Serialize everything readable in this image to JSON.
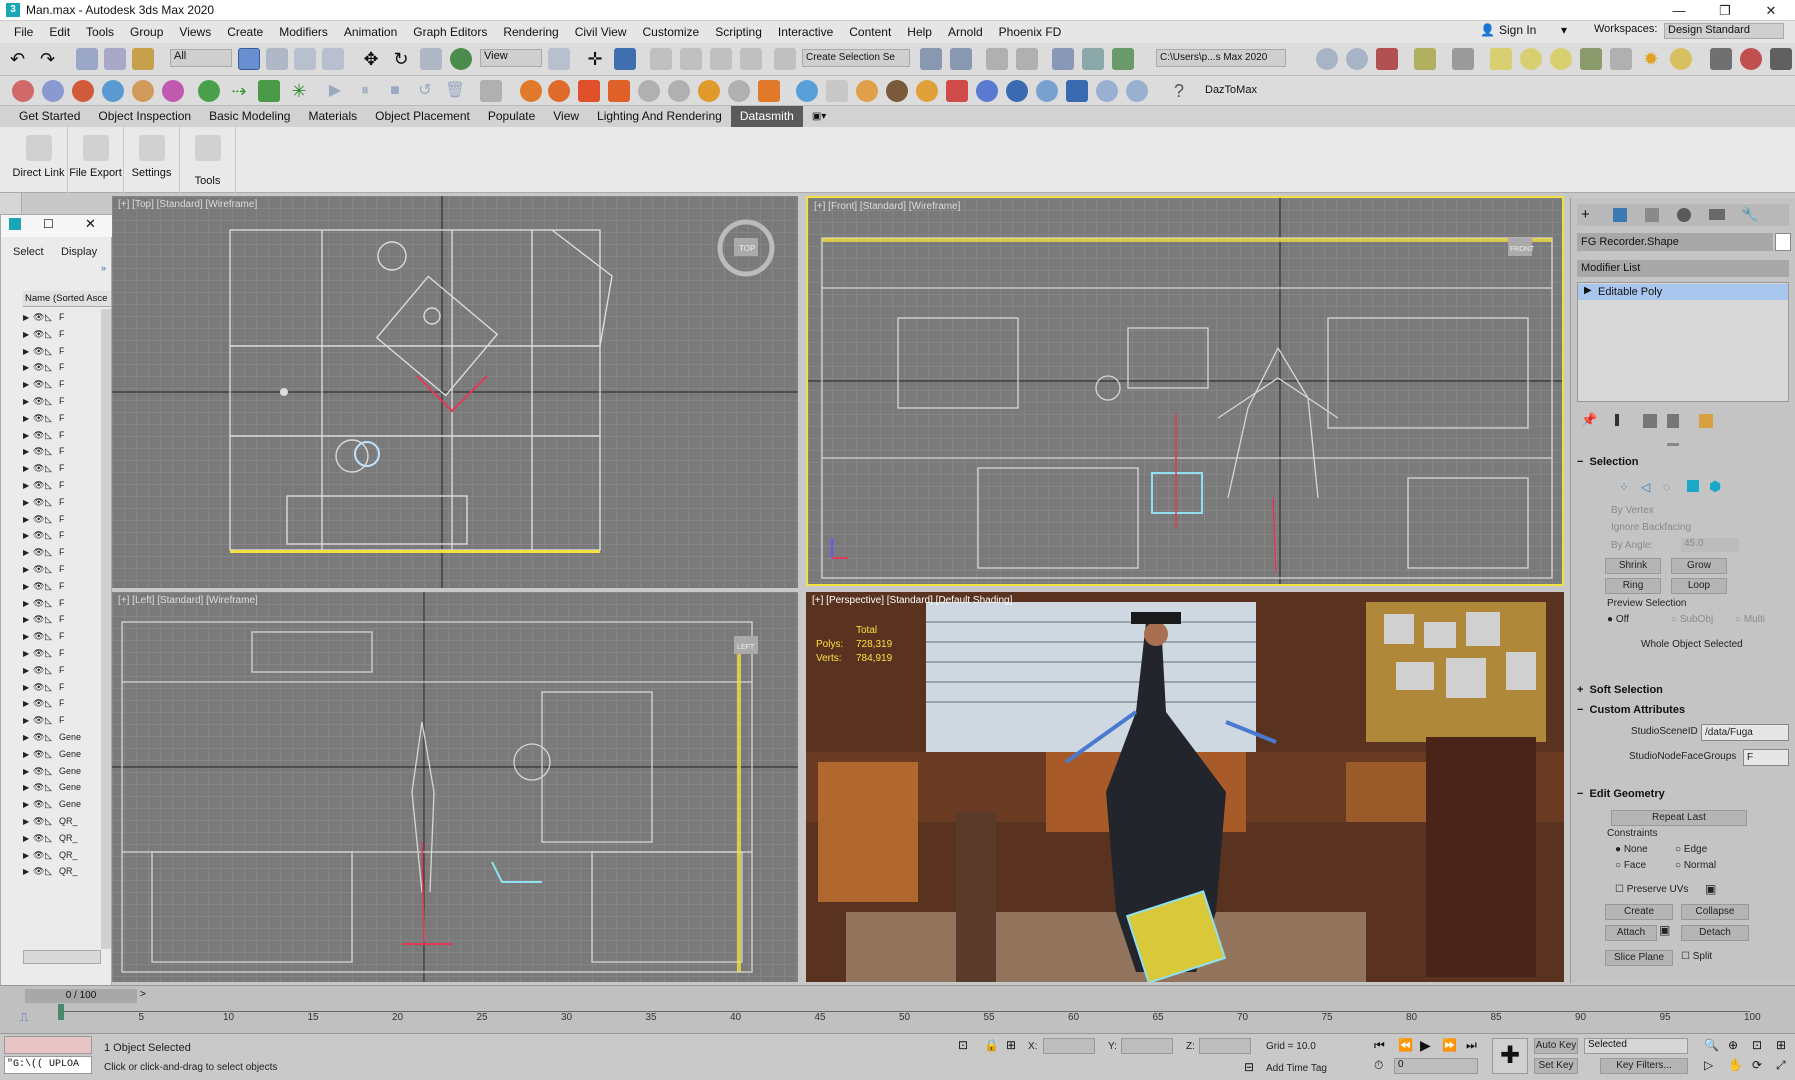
{
  "title": {
    "app_title": "Man.max - Autodesk 3ds Max 2020",
    "minimize": "—",
    "maximize": "❐",
    "close": "✕"
  },
  "menu": {
    "items": [
      "File",
      "Edit",
      "Tools",
      "Group",
      "Views",
      "Create",
      "Modifiers",
      "Animation",
      "Graph Editors",
      "Rendering",
      "Civil View",
      "Customize",
      "Scripting",
      "Interactive",
      "Content",
      "Help",
      "Arnold",
      "Phoenix FD"
    ],
    "sign_in": "Sign In",
    "workspaces_label": "Workspaces:",
    "workspace_value": "Design Standard"
  },
  "toolbar": {
    "filter_value": "All",
    "view_value": "View",
    "create_selection_placeholder": "Create Selection Se",
    "path_value": "C:\\Users\\p...s Max 2020",
    "daz_label": "DazToMax"
  },
  "ribbon": {
    "tabs": [
      "Get Started",
      "Object Inspection",
      "Basic Modeling",
      "Materials",
      "Object Placement",
      "Populate",
      "View",
      "Lighting And Rendering",
      "Datasmith"
    ],
    "active_tab": "Datasmith",
    "groups": [
      "Direct Link",
      "File Export",
      "Settings",
      "Tools"
    ]
  },
  "explorer": {
    "tab_select": "Select",
    "tab_display": "Display",
    "column_header": "Name (Sorted Asce",
    "rows": [
      "F",
      "F",
      "F",
      "F",
      "F",
      "F",
      "F",
      "F",
      "F",
      "F",
      "F",
      "F",
      "F",
      "F",
      "F",
      "F",
      "F",
      "F",
      "F",
      "F",
      "F",
      "F",
      "F",
      "F",
      "F",
      "Gene",
      "Gene",
      "Gene",
      "Gene",
      "Gene",
      "QR_",
      "QR_",
      "QR_",
      "QR_"
    ],
    "footer": "0 / 100"
  },
  "viewports": {
    "top_label": "[+] [Top] [Standard] [Wireframe]",
    "front_label": "[+] [Front] [Standard] [Wireframe]",
    "left_label": "[+] [Left] [Standard] [Wireframe]",
    "persp_label": "[+] [Perspective] [Standard] [Default Shading]",
    "stats_total": "Total",
    "stats_polys_label": "Polys:",
    "stats_polys": "728,319",
    "stats_verts_label": "Verts:",
    "stats_verts": "784,919",
    "viewcube_top": "TOP",
    "viewcube_front": "FRONT",
    "viewcube_left": "LEFT"
  },
  "command_panel": {
    "object_name": "FG Recorder.Shape",
    "modifier_list": "Modifier List",
    "stack_item": "Editable Poly",
    "selection_title": "Selection",
    "by_vertex": "By Vertex",
    "ignore_backfacing": "Ignore Backfacing",
    "by_angle": "By Angle:",
    "angle_value": "45.0",
    "shrink": "Shrink",
    "grow": "Grow",
    "ring": "Ring",
    "loop": "Loop",
    "preview_selection": "Preview Selection",
    "off": "Off",
    "subobj": "SubObj",
    "multi": "Multi",
    "whole_object": "Whole Object Selected",
    "soft_selection": "Soft Selection",
    "custom_attributes": "Custom Attributes",
    "studio_scene_id_label": "StudioSceneID",
    "studio_scene_id_value": "/data/Fuga",
    "studio_node_face_groups_label": "StudioNodeFaceGroups",
    "studio_node_face_groups_value": "F",
    "edit_geometry": "Edit Geometry",
    "repeat_last": "Repeat Last",
    "constraints": "Constraints",
    "none": "None",
    "edge": "Edge",
    "face": "Face",
    "normal": "Normal",
    "preserve_uvs": "Preserve UVs",
    "create": "Create",
    "collapse": "Collapse",
    "attach": "Attach",
    "detach": "Detach",
    "slice_plane": "Slice Plane",
    "split": "Split"
  },
  "timeline": {
    "ticks": [
      "5",
      "10",
      "15",
      "20",
      "25",
      "30",
      "35",
      "40",
      "45",
      "50",
      "55",
      "60",
      "65",
      "70",
      "75",
      "80",
      "85",
      "90",
      "95",
      "100"
    ],
    "frame_counter": "0 / 100"
  },
  "status": {
    "maxscript_text": "\"G:\\(( UPLOA",
    "objects_selected": "1 Object Selected",
    "prompt": "Click or click-and-drag to select objects",
    "x_label": "X:",
    "y_label": "Y:",
    "z_label": "Z:",
    "grid": "Grid = 10.0",
    "add_time_tag": "Add Time Tag",
    "auto_key": "Auto Key",
    "selected_dropdown": "Selected",
    "set_key": "Set Key",
    "key_filters": "Key Filters...",
    "frame_value": "0"
  },
  "colors": {
    "accent_yellow": "#f0e040",
    "active_tab": "#5a5a5a",
    "stack_highlight": "#a9c6ee",
    "persp_bg": "#6b3f2a"
  }
}
